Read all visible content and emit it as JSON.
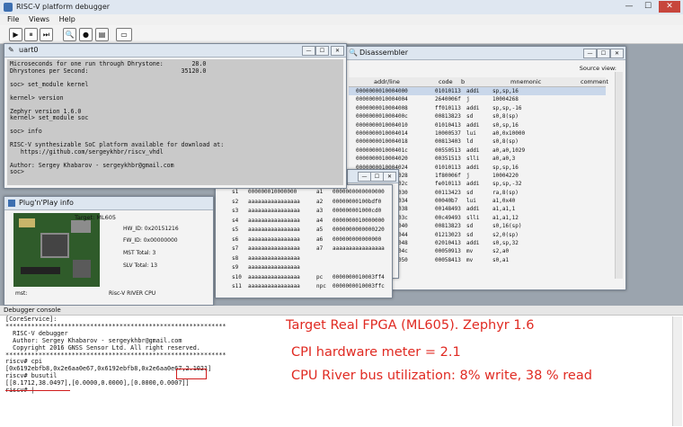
{
  "app": {
    "title": "RISC-V platform debugger",
    "menu": [
      "File",
      "Views",
      "Help"
    ],
    "window_controls": {
      "minimize": "—",
      "maximize": "☐",
      "close": "✕"
    }
  },
  "toolbar": {
    "buttons": [
      {
        "name": "run",
        "glyph": "▶"
      },
      {
        "name": "pause",
        "glyph": "⏸"
      },
      {
        "name": "step",
        "glyph": "⏭"
      },
      {
        "name": "zoom",
        "glyph": "🔍"
      },
      {
        "name": "stop",
        "glyph": "●"
      },
      {
        "name": "memory",
        "glyph": "▤"
      },
      {
        "name": "screen",
        "glyph": "▭"
      }
    ]
  },
  "uart": {
    "title": "uart0",
    "text": "Microseconds for one run through Dhrystone:        28.0\nDhrystones per Second:                          35120.0\n\nsoc> set_module kernel\n\nkernel> version\n\nZephyr version 1.6.0\nkernel> set_module soc\n\nsoc> info\n\nRISC-V synthesizable SoC platform available for download at:\n   https://github.com/sergeykhbr/riscv_vhdl\n\nAuthor: Sergey Khabarov - sergeykhbr@gmail.com\nsoc>"
  },
  "disassembler": {
    "title": "Disassembler",
    "source_view_label": "Source view:",
    "columns": [
      "addr/line",
      "code",
      "b",
      "mnemonic",
      "comment"
    ],
    "rows": [
      [
        "0000000010004000",
        "01010113",
        "addi",
        "sp,sp,16"
      ],
      [
        "0000000010004004",
        "2640006f",
        "j",
        "10004268"
      ],
      [
        "0000000010004008",
        "ff010113",
        "addi",
        "sp,sp,-16"
      ],
      [
        "000000001000400c",
        "00813823",
        "sd",
        "s0,8(sp)"
      ],
      [
        "0000000010004010",
        "01010413",
        "addi",
        "s0,sp,16"
      ],
      [
        "0000000010004014",
        "10000537",
        "lui",
        "a0,0x10000"
      ],
      [
        "0000000010004018",
        "00813403",
        "ld",
        "s0,8(sp)"
      ],
      [
        "000000001000401c",
        "00550513",
        "addi",
        "a0,a0,1029"
      ],
      [
        "0000000010004020",
        "00351513",
        "slli",
        "a0,a0,3"
      ],
      [
        "0000000010004024",
        "01010113",
        "addi",
        "sp,sp,16"
      ],
      [
        "0000000010004028",
        "1f80006f",
        "j",
        "10004220"
      ],
      [
        "000000001000402c",
        "fe010113",
        "addi",
        "sp,sp,-32"
      ],
      [
        "0000000010004030",
        "00113423",
        "sd",
        "ra,8(sp)"
      ],
      [
        "0000000010004034",
        "00040b7",
        "lui",
        "a1,0x40"
      ],
      [
        "0000000010004038",
        "00148493",
        "addi",
        "a1,a1,1"
      ],
      [
        "000000001000403c",
        "00c49493",
        "slli",
        "a1,a1,12"
      ],
      [
        "0000000010004040",
        "00813823",
        "sd",
        "s0,16(sp)"
      ],
      [
        "0000000010004044",
        "01213023",
        "sd",
        "s2,0(sp)"
      ],
      [
        "0000000010004048",
        "02010413",
        "addi",
        "s0,sp,32"
      ],
      [
        "000000001000404c",
        "00050913",
        "mv",
        "s2,a0"
      ],
      [
        "0000000010004050",
        "00058413",
        "mv",
        "s0,a1"
      ]
    ]
  },
  "registers": {
    "rows": [
      {
        "n1": "s1",
        "v1": "000000010000000",
        "n2": "a1",
        "v2": "0000000000000000"
      },
      {
        "n1": "s2",
        "v1": "aaaaaaaaaaaaaaaa",
        "n2": "a2",
        "v2": "00000000100bdf0"
      },
      {
        "n1": "s3",
        "v1": "aaaaaaaaaaaaaaaa",
        "n2": "a3",
        "v2": "000000001000cd0"
      },
      {
        "n1": "s4",
        "v1": "aaaaaaaaaaaaaaaa",
        "n2": "a4",
        "v2": "0000000010000000"
      },
      {
        "n1": "s5",
        "v1": "aaaaaaaaaaaaaaaa",
        "n2": "a5",
        "v2": "0000000000000220"
      },
      {
        "n1": "s6",
        "v1": "aaaaaaaaaaaaaaaa",
        "n2": "a6",
        "v2": "000000000000000"
      },
      {
        "n1": "s7",
        "v1": "aaaaaaaaaaaaaaaa",
        "n2": "a7",
        "v2": "aaaaaaaaaaaaaaaa"
      },
      {
        "n1": "s8",
        "v1": "aaaaaaaaaaaaaaaa",
        "n2": "",
        "v2": ""
      },
      {
        "n1": "s9",
        "v1": "aaaaaaaaaaaaaaaa",
        "n2": "",
        "v2": ""
      },
      {
        "n1": "s10",
        "v1": "aaaaaaaaaaaaaaaa",
        "n2": "pc",
        "v2": "0000000010003ff4"
      },
      {
        "n1": "s11",
        "v1": "aaaaaaaaaaaaaaaa",
        "n2": "npc",
        "v2": "0000000010003ffc"
      }
    ],
    "extra_values": [
      "000000001000bdf0",
      "000000000000000"
    ]
  },
  "pnp": {
    "title": "Plug'n'Play info",
    "target": "Target: ML605",
    "hw_id": "HW_ID: 0x20151216",
    "fw_id": "FW_ID: 0x00000000",
    "mst_total": "MST Total: 3",
    "slv_total": "SLV Total: 13",
    "mst_label": "mst:",
    "mst_value": "Risc-V RIVER CPU"
  },
  "console": {
    "title": "Debugger console",
    "lines": [
      "[CoreService]:",
      "************************************************************",
      "  RISC-V debugger",
      "  Author: Sergey Khabarov - sergeykhbr@gmail.com",
      "  Copyright 2016 GNSS Sensor Ltd. All right reserved.",
      "************************************************************",
      "riscv# cpi",
      "[0x6192ebfb8,0x2e6aa0e67,0x6192ebfb8,0x2e6aa0e67,2.1021]",
      "riscv# busutil",
      "[[8.1712,38.0497],[0.0000,0.0000],[0.0000,0.0007]]",
      "riscv# |"
    ]
  },
  "annotations": {
    "line1": "Target Real FPGA (ML605). Zephyr 1.6",
    "line2": "CPI hardware meter = 2.1",
    "line3": "CPU River bus utilization: 8% write, 38 % read",
    "color": "#e02a22"
  }
}
